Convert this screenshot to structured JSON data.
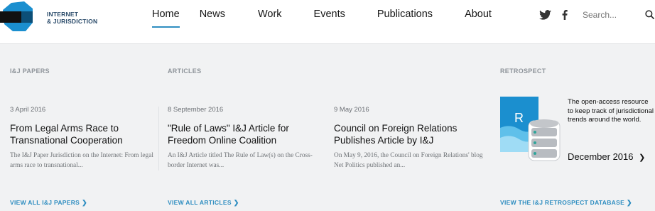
{
  "header": {
    "logo": {
      "line1": "INTERNET",
      "line2": "& JURISDICTION"
    },
    "nav": [
      {
        "label": "Home",
        "active": true
      },
      {
        "label": "News"
      },
      {
        "label": "Work"
      },
      {
        "label": "Events"
      },
      {
        "label": "Publications"
      },
      {
        "label": "About"
      }
    ],
    "social": {
      "twitter_icon": "twitter-icon",
      "facebook_icon": "facebook-icon"
    },
    "search": {
      "placeholder": "Search...",
      "icon": "search-icon"
    }
  },
  "columns": {
    "papers": {
      "label": "I&J PAPERS",
      "date": "3 April 2016",
      "title": "From Legal Arms Race to Transnational Cooperation",
      "excerpt": "The I&J Paper Jurisdiction on the Internet: From legal arms race to transnational...",
      "view_all": "VIEW ALL I&J PAPERS"
    },
    "articles": {
      "label": "ARTICLES",
      "items": [
        {
          "date": "8 September 2016",
          "title": "\"Rule of Laws\" I&J Article for Freedom Online Coalition",
          "excerpt": "An I&J Article titled The Rule of Law(s) on the Cross-border Internet was..."
        },
        {
          "date": "9 May 2016",
          "title": "Council on Foreign Relations Publishes Article by I&J",
          "excerpt": "On May 9, 2016, the Council on Foreign Relations' blog Net Politics published an..."
        }
      ],
      "view_all": "VIEW ALL ARTICLES"
    },
    "retrospect": {
      "label": "RETROSPECT",
      "image_letter": "R",
      "description": "The open-access resource to keep track of jurisdictional trends around the world.",
      "edition": "December 2016",
      "view_all": "VIEW THE I&J RETROSPECT DATABASE"
    }
  },
  "colors": {
    "accent": "#2f8ec1",
    "logo_blue": "#1b8fcf",
    "background": "#f1f2f3"
  }
}
